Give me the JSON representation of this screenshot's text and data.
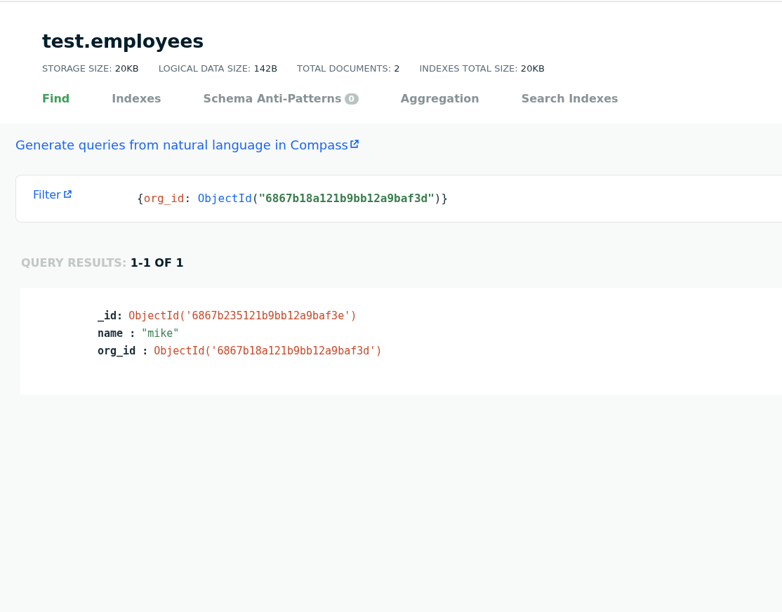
{
  "collection": {
    "title": "test.employees",
    "stats": [
      {
        "label": "STORAGE SIZE:",
        "value": "20KB"
      },
      {
        "label": "LOGICAL DATA SIZE:",
        "value": "142B"
      },
      {
        "label": "TOTAL DOCUMENTS:",
        "value": "2"
      },
      {
        "label": "INDEXES TOTAL SIZE:",
        "value": "20KB"
      }
    ]
  },
  "tabs": [
    {
      "label": "Find",
      "selected": true
    },
    {
      "label": "Indexes",
      "selected": false
    },
    {
      "label": "Schema Anti-Patterns",
      "selected": false,
      "badge": "0"
    },
    {
      "label": "Aggregation",
      "selected": false
    },
    {
      "label": "Search Indexes",
      "selected": false
    }
  ],
  "nl_link": "Generate queries from natural language in Compass",
  "filter": {
    "label": "Filter",
    "query": [
      {
        "kind": "punct",
        "text": "{"
      },
      {
        "kind": "key",
        "text": "org_id"
      },
      {
        "kind": "punct",
        "text": ": "
      },
      {
        "kind": "func",
        "text": "ObjectId"
      },
      {
        "kind": "punct",
        "text": "("
      },
      {
        "kind": "string",
        "text": "\"6867b18a121b9bb12a9baf3d\""
      },
      {
        "kind": "punct",
        "text": ")}"
      }
    ]
  },
  "results": {
    "label": "QUERY RESULTS:",
    "count": "1-1 OF 1"
  },
  "document": [
    {
      "key": "_id:",
      "value": "ObjectId('6867b235121b9bb12a9baf3e')",
      "kind": "objectid"
    },
    {
      "key": "name :",
      "value": "\"mike\"",
      "kind": "string"
    },
    {
      "key": "org_id :",
      "value": "ObjectId('6867b18a121b9bb12a9baf3d')",
      "kind": "objectid"
    }
  ]
}
